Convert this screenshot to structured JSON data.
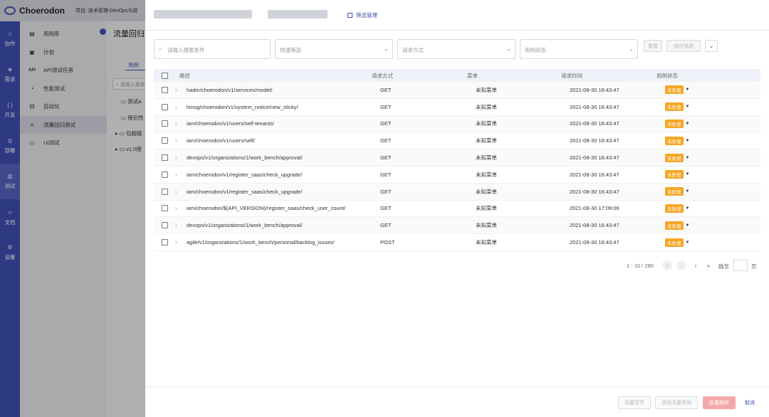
{
  "app": {
    "logo_text": "Choerodon",
    "project_label": "项目: 技术管理-DevOps与容"
  },
  "rail": [
    {
      "icon": "协",
      "label": "协作"
    },
    {
      "icon": "需",
      "label": "需求"
    },
    {
      "icon": "开",
      "label": "开发"
    },
    {
      "icon": "部",
      "label": "部署"
    },
    {
      "icon": "测",
      "label": "测试"
    },
    {
      "icon": "文",
      "label": "文档"
    },
    {
      "icon": "设",
      "label": "设置"
    }
  ],
  "menu": [
    {
      "icon": "▤",
      "label": "用例库"
    },
    {
      "icon": "▣",
      "label": "计划"
    },
    {
      "icon": "API",
      "label": "API测试任务"
    },
    {
      "icon": "◔",
      "label": "性能测试"
    },
    {
      "icon": "⊡",
      "label": "自动化"
    },
    {
      "icon": "≡",
      "label": "流量回归测试"
    },
    {
      "icon": "▭",
      "label": "UI测试"
    }
  ],
  "content": {
    "title": "流量回归测试",
    "tab": "用例",
    "search_placeholder": "请输入搜索",
    "tree": [
      "测试a",
      "接近性",
      "包超级",
      "v1.0接"
    ]
  },
  "drawer": {
    "filter_management": "筛选管理",
    "search_placeholder": "请输入搜索条件",
    "filters": [
      "快速筛选",
      "请求方式",
      "用例状态"
    ],
    "reset_label": "重置",
    "save_filter_label": "保存筛选",
    "expand_icon": "chevron-down-icon",
    "columns": [
      "路径",
      "请求方式",
      "菜单",
      "请求时间",
      "用例状态"
    ],
    "rows": [
      {
        "path": "hadm/choerodon/v1/services/model/",
        "method": "GET",
        "menu": "未知菜单",
        "time": "2021-08-30 16:43:47",
        "status": "未处理"
      },
      {
        "path": "hmsg/choerodon/v1/system_notice/new_sticky/",
        "method": "GET",
        "menu": "未知菜单",
        "time": "2021-08-30 16:43:47",
        "status": "未处理"
      },
      {
        "path": "iam/choerodon/v1/users/self-tenants/",
        "method": "GET",
        "menu": "未知菜单",
        "time": "2021-08-30 16:43:47",
        "status": "未处理"
      },
      {
        "path": "iam/choerodon/v1/users/self/",
        "method": "GET",
        "menu": "未知菜单",
        "time": "2021-08-30 16:43:47",
        "status": "未处理"
      },
      {
        "path": "devops/v1/organizations/1/work_bench/approval/",
        "method": "GET",
        "menu": "未知菜单",
        "time": "2021-08-30 16:43:47",
        "status": "未处理"
      },
      {
        "path": "iam/choerodon/v1/register_saas/check_upgrade/",
        "method": "GET",
        "menu": "未知菜单",
        "time": "2021-08-30 16:43:47",
        "status": "未处理"
      },
      {
        "path": "iam/choerodon/v1/register_saas/check_upgrade/",
        "method": "GET",
        "menu": "未知菜单",
        "time": "2021-08-30 16:43:47",
        "status": "未处理"
      },
      {
        "path": "iam/choerodon/$(API_VERSION)/register_saas/check_user_count/",
        "method": "GET",
        "menu": "未知菜单",
        "time": "2021-08-30 17:09:06",
        "status": "未处理"
      },
      {
        "path": "devops/v1/organizations/1/work_bench/approval/",
        "method": "GET",
        "menu": "未知菜单",
        "time": "2021-08-30 16:43:47",
        "status": "未处理"
      },
      {
        "path": "agile/v1/organizations/1/work_bench/personal/backlog_issues/",
        "method": "POST",
        "menu": "未知菜单",
        "time": "2021-08-30 16:43:47",
        "status": "未处理"
      }
    ],
    "pagination": {
      "total_text": "1 - 10 / 280",
      "jump_label": "跳至",
      "page_unit": "页"
    },
    "footer": {
      "pause_label": "流量暂停",
      "add_label": "添加流量用例",
      "delete_label": "批量删除",
      "cancel_label": "取消"
    }
  },
  "colors": {
    "brand": "#3f51b5",
    "status_badge": "#f5a623",
    "danger": "#f4a8a8"
  }
}
